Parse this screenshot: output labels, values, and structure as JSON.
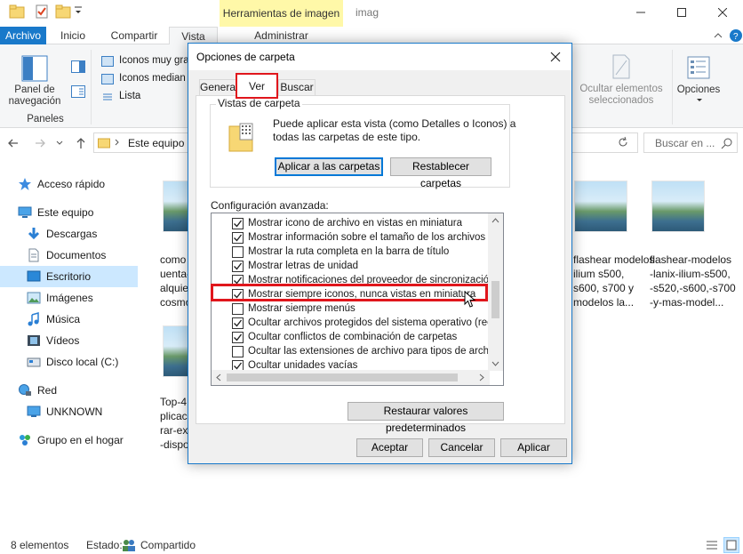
{
  "window": {
    "tools_context_tab": "Herramientas de imagen",
    "title": "imag"
  },
  "ribbon": {
    "tabs": [
      "Archivo",
      "Inicio",
      "Compartir",
      "Vista",
      "Administrar"
    ],
    "navigation_pane_label": "Panel de\nnavegación",
    "panes_group_label": "Paneles",
    "layout_options": [
      "Iconos muy gra",
      "Iconos median",
      "Lista"
    ],
    "hide_selected_label": "Ocultar elementos\nseleccionados",
    "options_label": "Opciones"
  },
  "address": {
    "path": "Este equipo",
    "search_placeholder": "Buscar en ..."
  },
  "nav": {
    "items": [
      "Acceso rápido",
      "Este equipo",
      "Descargas",
      "Documentos",
      "Escritorio",
      "Imágenes",
      "Música",
      "Vídeos",
      "Disco local (C:)",
      "Red",
      "UNKNOWN",
      "Grupo en el hogar"
    ],
    "selected": "Escritorio"
  },
  "files": [
    {
      "name": "como\nuenta-\nalquie\ncosmo"
    },
    {
      "name": "flashear modelos\nilium s500,\ns600, s700 y\nmodelos la..."
    },
    {
      "name": "flashear-modelos\n-lanix-ilium-s500,\n-s520,-s600,-s700\n-y-mas-model..."
    },
    {
      "name": "Top-4\nplicac\nrar-ext\n-dispo"
    }
  ],
  "status": {
    "item_count": "8 elementos",
    "state_label": "Estado:",
    "state_value": "Compartido"
  },
  "dialog": {
    "title": "Opciones de carpeta",
    "tabs": [
      "General",
      "Ver",
      "Buscar"
    ],
    "active_tab": "Ver",
    "folder_views": {
      "group_label": "Vistas de carpeta",
      "description": "Puede aplicar esta vista (como Detalles o Iconos) a\ntodas las carpetas de este tipo.",
      "apply_button": "Aplicar a las carpetas",
      "reset_button": "Restablecer carpetas"
    },
    "advanced_label": "Configuración avanzada:",
    "advanced_settings": [
      {
        "label": "Mostrar icono de archivo en vistas en miniatura",
        "checked": true
      },
      {
        "label": "Mostrar información sobre el tamaño de los archivos en su",
        "checked": true
      },
      {
        "label": "Mostrar la ruta completa en la barra de título",
        "checked": false
      },
      {
        "label": "Mostrar letras de unidad",
        "checked": true
      },
      {
        "label": "Mostrar notificaciones del proveedor de sincronización",
        "checked": true
      },
      {
        "label": "Mostrar siempre iconos, nunca vistas en miniatura",
        "checked": true
      },
      {
        "label": "Mostrar siempre menús",
        "checked": false
      },
      {
        "label": "Ocultar archivos protegidos del sistema operativo (recome",
        "checked": true
      },
      {
        "label": "Ocultar conflictos de combinación de carpetas",
        "checked": true
      },
      {
        "label": "Ocultar las extensiones de archivo para tipos de archivo c",
        "checked": false
      },
      {
        "label": "Ocultar unidades vacías",
        "checked": true
      }
    ],
    "restore_defaults_button": "Restaurar valores predeterminados",
    "accept_button": "Aceptar",
    "cancel_button": "Cancelar",
    "apply_button": "Aplicar"
  },
  "colors": {
    "accent": "#1979ca",
    "highlight": "#e0161c",
    "tools_tab": "#fff8a8",
    "nav_selected": "#cce8ff"
  }
}
